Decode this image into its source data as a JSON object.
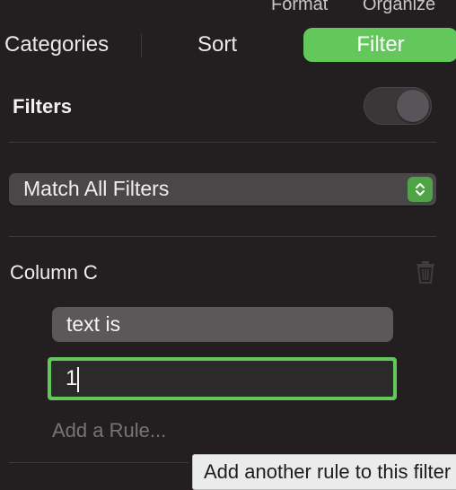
{
  "top_tabs": [
    "Format",
    "Organize"
  ],
  "segments": {
    "categories": "Categories",
    "sort": "Sort",
    "filter": "Filter"
  },
  "filters": {
    "heading": "Filters",
    "toggle_on": false,
    "match_mode": "Match All Filters"
  },
  "rule_group": {
    "column": "Column C",
    "condition": "text is",
    "value": "1",
    "add_rule": "Add a Rule..."
  },
  "tooltip": "Add another rule to this filter",
  "colors": {
    "accent": "#63c75b",
    "background": "#231f21",
    "control": "#4a4749"
  },
  "icons": {
    "delete": "trash-icon",
    "stepper": "up-down-chevron-icon"
  }
}
